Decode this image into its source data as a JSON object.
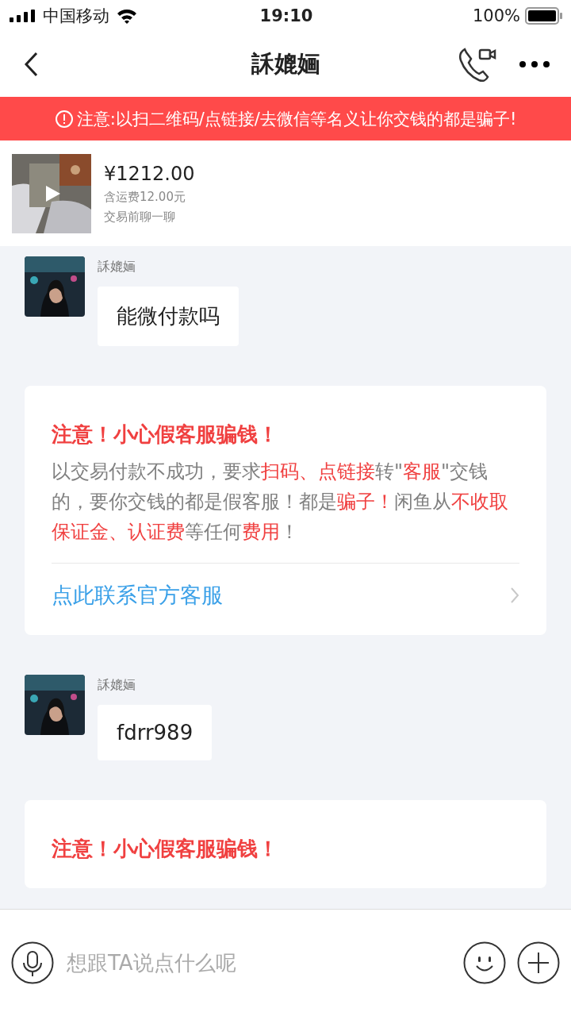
{
  "status_bar": {
    "carrier": "中国移动",
    "time": "19:10",
    "battery": "100%"
  },
  "header": {
    "title": "訸媲婳"
  },
  "banner": {
    "text": "注意:以扫二维码/点链接/去微信等名义让你交钱的都是骗子!"
  },
  "product": {
    "kind": "picture",
    "price": "¥1212.00",
    "shipping": "含运费12.00元",
    "note": "交易前聊一聊"
  },
  "chat": [
    {
      "kind": "message",
      "sender": "訸媲婳",
      "text": "能微付款吗"
    },
    {
      "kind": "warning",
      "title": "注意！小心假客服骗钱！",
      "body": [
        {
          "text": "以交易付款不成功，要求",
          "highlight": false
        },
        {
          "text": "扫码、点链接",
          "highlight": true
        },
        {
          "text": "转\"",
          "highlight": false
        },
        {
          "text": "客服",
          "highlight": true
        },
        {
          "text": "\"交钱的，要你交钱的都是假客服！都是",
          "highlight": false
        },
        {
          "text": "骗子！",
          "highlight": true
        },
        {
          "text": "闲鱼从",
          "highlight": false
        },
        {
          "text": "不收取保证金、认证费",
          "highlight": true
        },
        {
          "text": "等任何",
          "highlight": false
        },
        {
          "text": "费用",
          "highlight": true
        },
        {
          "text": "！",
          "highlight": false
        }
      ],
      "link": "点此联系官方客服"
    },
    {
      "kind": "message",
      "sender": "訸媲婳",
      "text": "fdrr989"
    },
    {
      "kind": "warning",
      "title": "注意！小心假客服骗钱！"
    }
  ],
  "input": {
    "placeholder": "想跟TA说点什么呢"
  }
}
